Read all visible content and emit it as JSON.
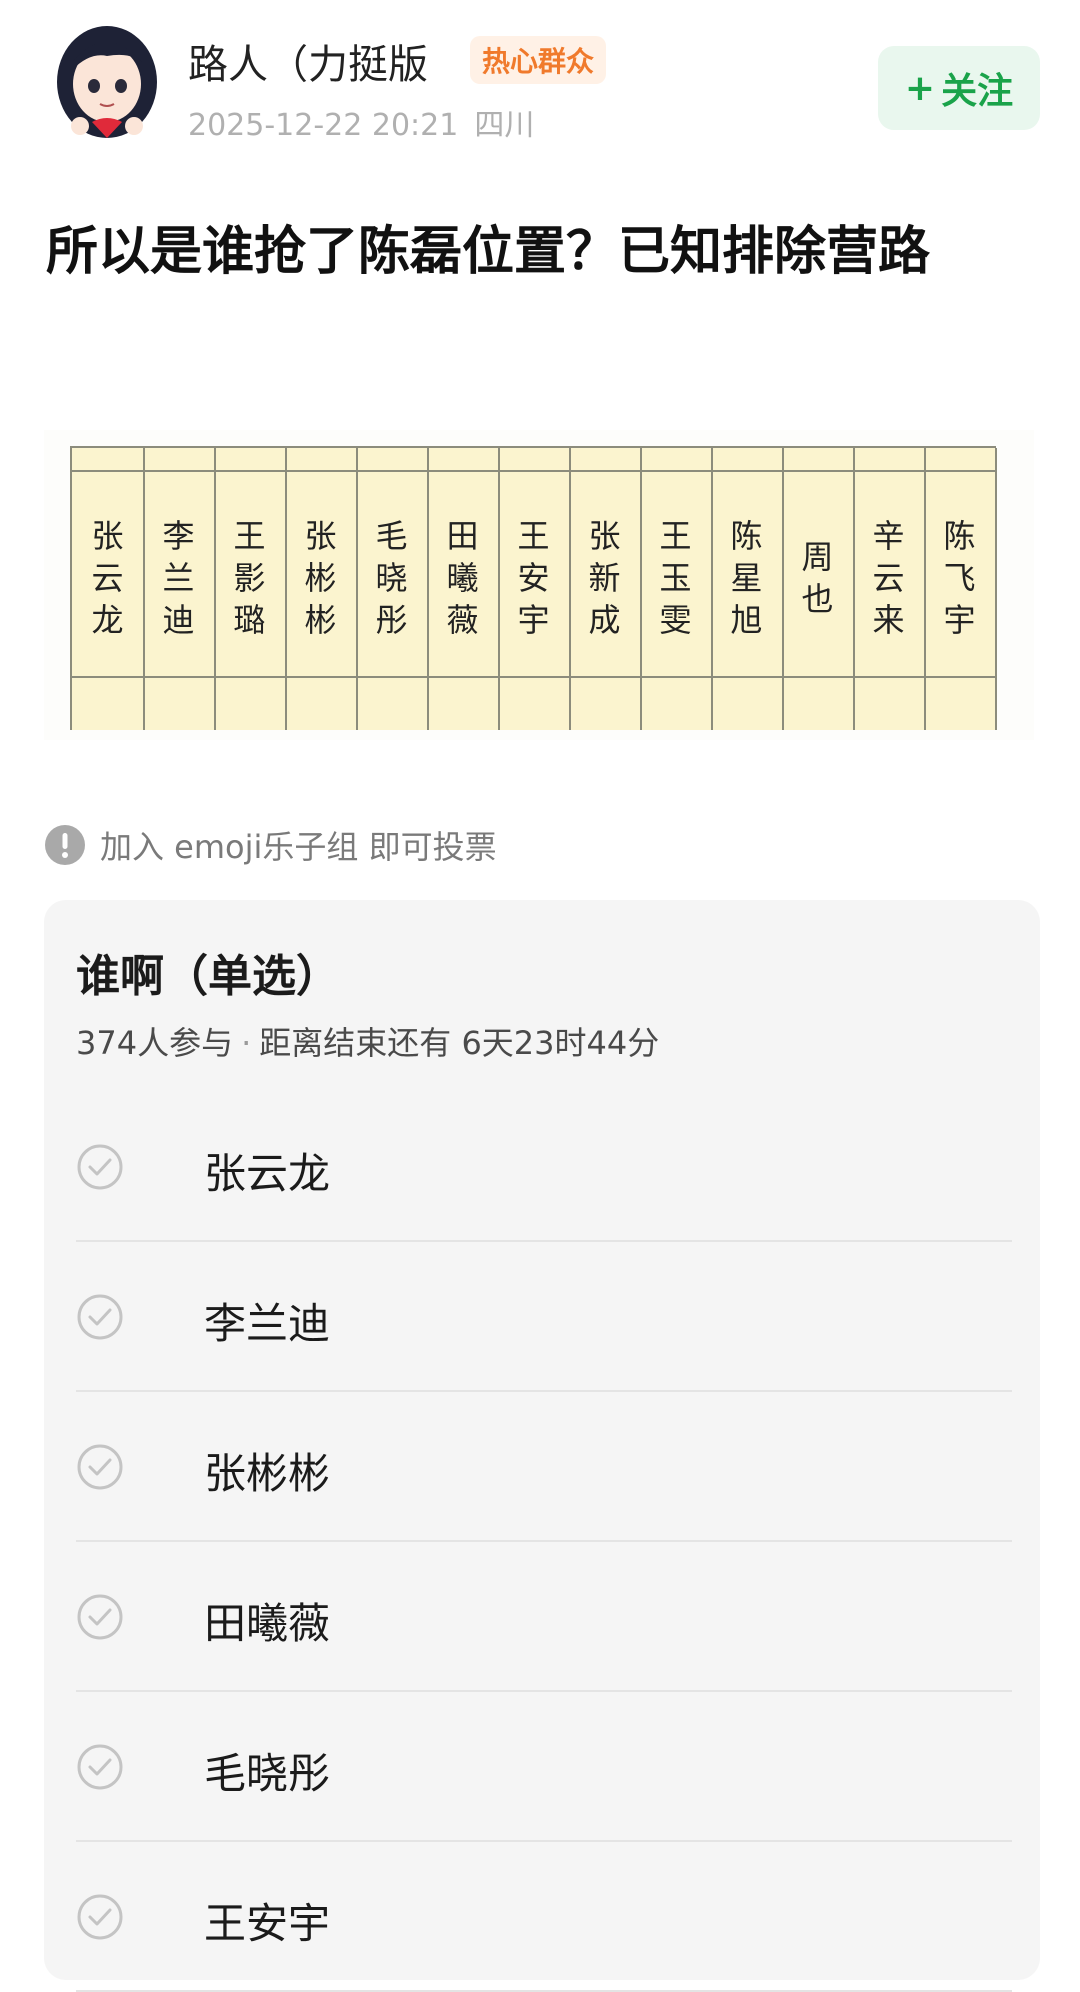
{
  "author": {
    "name": "路人（力挺版",
    "badge": "热心群众",
    "time": "2025-12-22 20:21",
    "location": "四川",
    "follow_label": "关注"
  },
  "post": {
    "title": "所以是谁抢了陈磊位置？已知排除营路",
    "image_names": [
      "张云龙",
      "李兰迪",
      "王影璐",
      "张彬彬",
      "毛晓彤",
      "田曦薇",
      "王安宇",
      "张新成",
      "王玉雯",
      "陈星旭",
      "周也",
      "辛云来",
      "陈飞宇"
    ]
  },
  "notice": {
    "text": "加入 emoji乐子组 即可投票"
  },
  "poll": {
    "title": "谁啊（单选）",
    "participants": "374人参与",
    "remaining": "距离结束还有 6天23时44分",
    "options": [
      "张云龙",
      "李兰迪",
      "张彬彬",
      "田曦薇",
      "毛晓彤",
      "王安宇"
    ]
  },
  "colors": {
    "accent_green": "#1aa34a",
    "badge_orange": "#f07a2c"
  }
}
